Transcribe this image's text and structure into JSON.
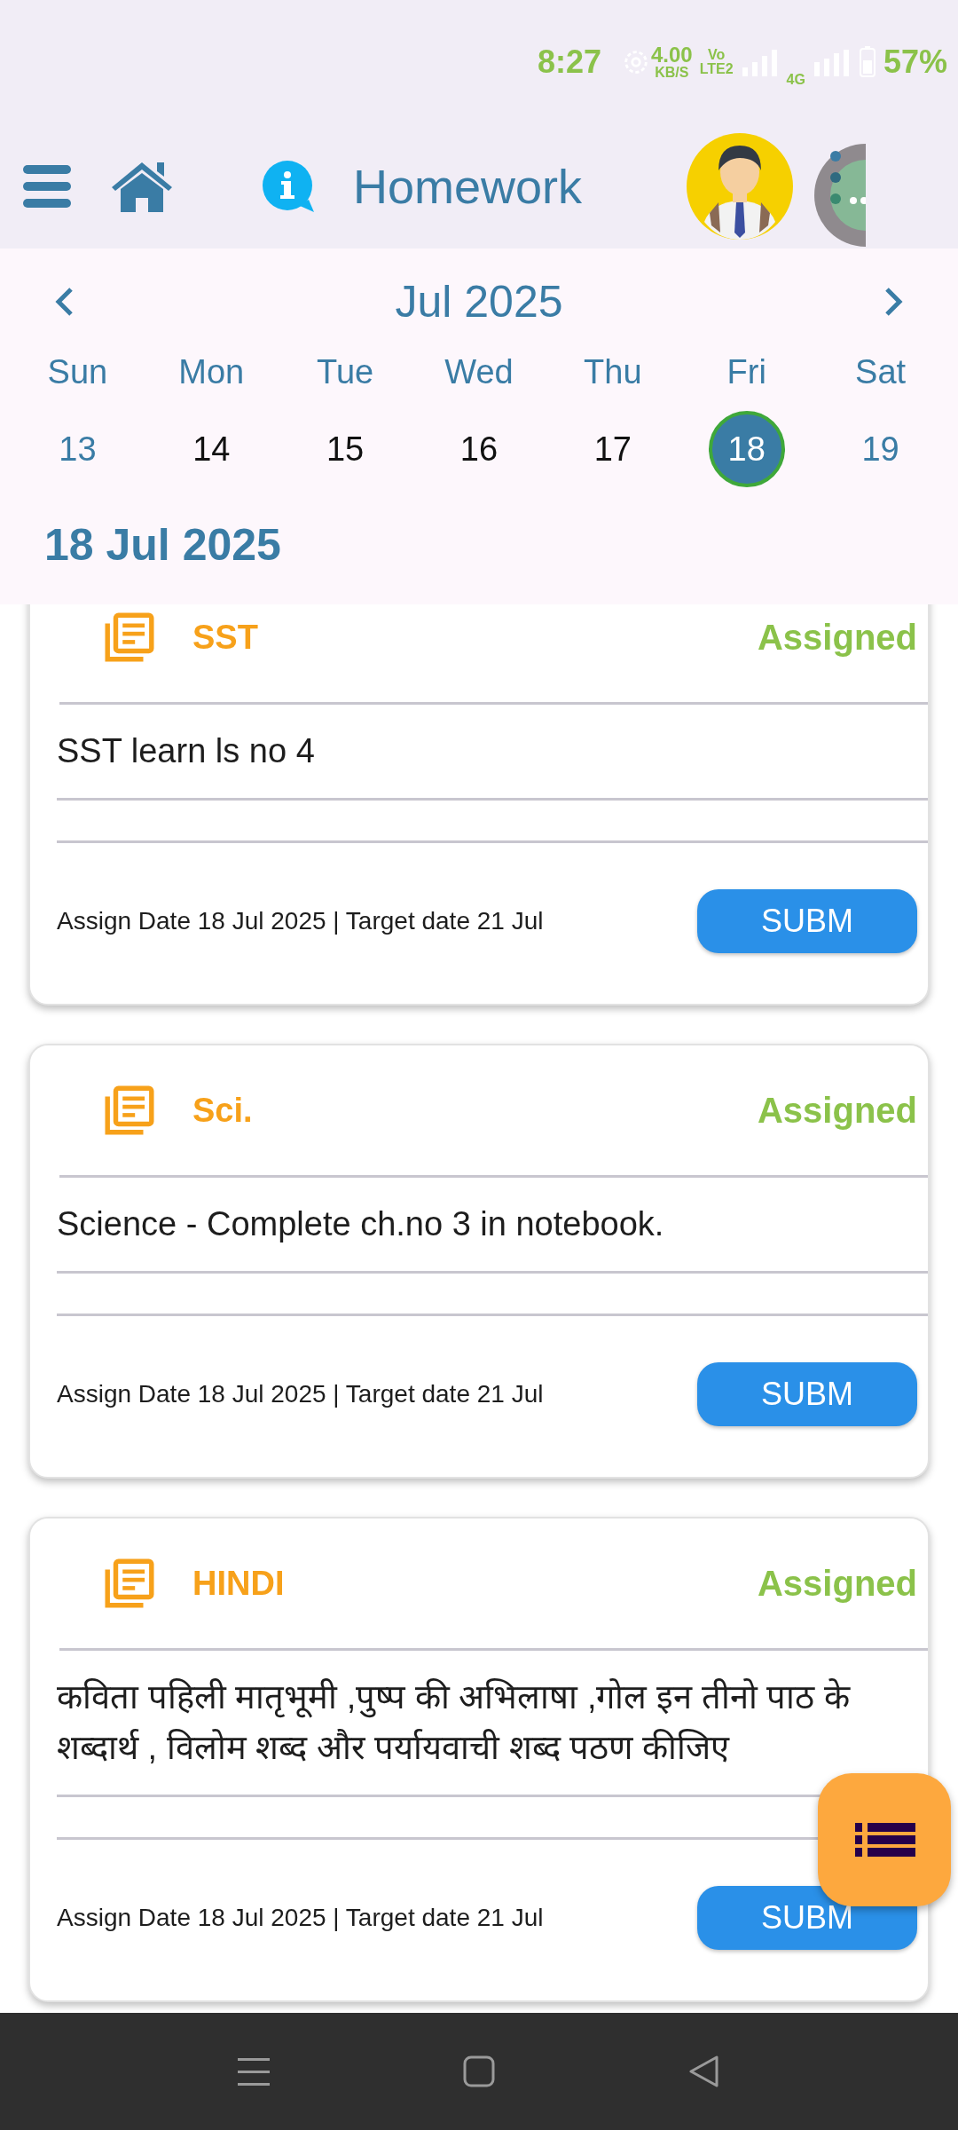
{
  "status_bar": {
    "time": "8:27",
    "speed": "4.00",
    "speed_unit": "KB/S",
    "volte": "Vo",
    "lte": "LTE2",
    "network": "4G",
    "battery": "57%"
  },
  "app_bar": {
    "title": "Homework"
  },
  "calendar": {
    "month": "Jul 2025",
    "weekdays": [
      "Sun",
      "Mon",
      "Tue",
      "Wed",
      "Thu",
      "Fri",
      "Sat"
    ],
    "days": [
      {
        "label": "13",
        "weekend": true,
        "selected": false
      },
      {
        "label": "14",
        "weekend": false,
        "selected": false
      },
      {
        "label": "15",
        "weekend": false,
        "selected": false
      },
      {
        "label": "16",
        "weekend": false,
        "selected": false
      },
      {
        "label": "17",
        "weekend": false,
        "selected": false
      },
      {
        "label": "18",
        "weekend": false,
        "selected": true
      },
      {
        "label": "19",
        "weekend": true,
        "selected": false
      }
    ],
    "selected_date": "18 Jul 2025"
  },
  "homework": [
    {
      "subject": "SST",
      "status": "Assigned",
      "description": "SST learn ls no 4",
      "dates": "Assign Date 18 Jul 2025 | Target date 21 Jul",
      "button": "SUBM"
    },
    {
      "subject": "Sci.",
      "status": "Assigned",
      "description": "Science - Complete ch.no 3 in notebook.",
      "dates": "Assign Date 18 Jul 2025 | Target date 21 Jul",
      "button": "SUBM"
    },
    {
      "subject": "HINDI",
      "status": "Assigned",
      "description": "कविता पहिली मातृभूमी ,पुष्प की अभिलाषा ,गोल इन तीनो पाठ के शब्दार्थ , विलोम शब्द और पर्यायवाची शब्द पठण कीजिए",
      "dates": "Assign Date 18 Jul 2025 | Target date 21 Jul",
      "button": "SUBM"
    }
  ]
}
